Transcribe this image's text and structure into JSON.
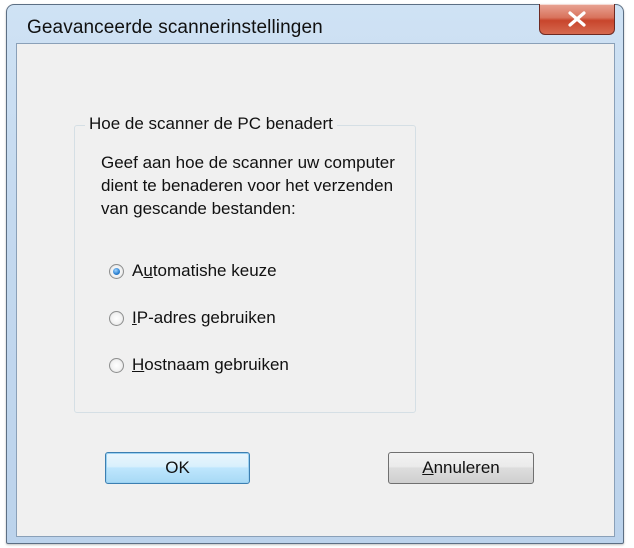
{
  "window": {
    "title": "Geavanceerde scannerinstellingen",
    "close_symbol": "x"
  },
  "group": {
    "legend": "Hoe de scanner de PC benadert",
    "description_lines": [
      "Geef aan hoe de scanner uw computer",
      "dient te benaderen voor het verzenden",
      "van gescande bestanden:"
    ],
    "options": [
      {
        "prefix": "A",
        "accel": "u",
        "rest": "tomatishe keuze",
        "checked": true
      },
      {
        "prefix": "",
        "accel": "I",
        "rest": "P-adres gebruiken",
        "checked": false
      },
      {
        "prefix": "",
        "accel": "H",
        "rest": "ostnaam gebruiken",
        "checked": false
      }
    ]
  },
  "buttons": {
    "ok_label": "OK",
    "cancel_accel": "A",
    "cancel_rest": "nnuleren"
  }
}
